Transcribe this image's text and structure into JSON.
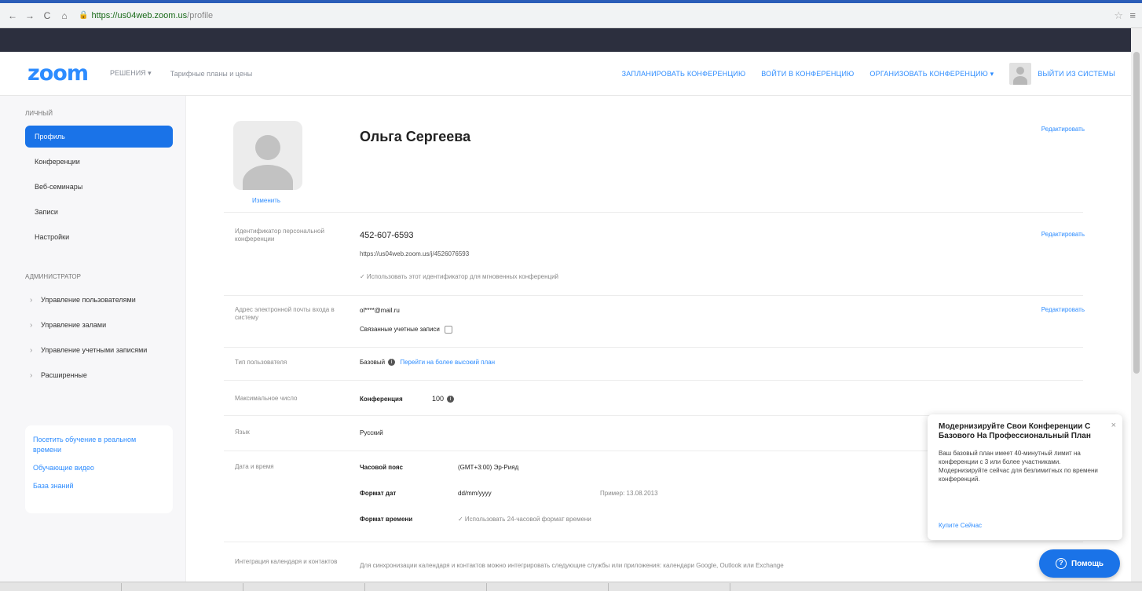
{
  "browser": {
    "url_host": "https://us04web.zoom.us",
    "url_path": "/profile"
  },
  "header": {
    "logo": "zoom",
    "nav": [
      "РЕШЕНИЯ ▾",
      "Тарифные планы и цены"
    ],
    "links": [
      "ЗАПЛАНИРОВАТЬ КОНФЕРЕНЦИЮ",
      "ВОЙТИ В КОНФЕРЕНЦИЮ",
      "ОРГАНИЗОВАТЬ КОНФЕРЕНЦИЮ ▾"
    ],
    "signout": "ВЫЙТИ ИЗ СИСТЕМЫ"
  },
  "sidebar": {
    "personal_title": "ЛИЧНЫЙ",
    "personal_items": [
      "Профиль",
      "Конференции",
      "Веб-семинары",
      "Записи",
      "Настройки"
    ],
    "admin_title": "АДМИНИСТРАТОР",
    "admin_items": [
      "Управление пользователями",
      "Управление залами",
      "Управление учетными записями",
      "Расширенные"
    ],
    "card_links": [
      "Посетить обучение в реальном времени",
      "Обучающие видео",
      "База знаний"
    ]
  },
  "profile": {
    "change_photo": "Изменить",
    "name": "Ольга Сергеева",
    "edit": "Редактировать",
    "pmi_label": "Идентификатор персональной конференции",
    "pmi_value": "452-607-6593",
    "pmi_url": "https://us04web.zoom.us/j/4526076593",
    "pmi_note": "✓ Использовать этот идентификатор для мгновенных конференций",
    "email_label": "Адрес электронной почты входа в систему",
    "email_value": "ol****@mail.ru",
    "linked_accounts": "Связанные учетные записи",
    "type_label": "Тип пользователя",
    "type_value": "Базовый",
    "upgrade_link": "Перейти на более высокий план",
    "capacity_label": "Максимальное число",
    "capacity_key": "Конференция",
    "capacity_value": "100",
    "lang_label": "Язык",
    "lang_value": "Русский",
    "datetime_label": "Дата и время",
    "tz_key": "Часовой пояс",
    "tz_value": "(GMT+3:00) Эр-Рияд",
    "date_key": "Формат дат",
    "date_value": "dd/mm/yyyy",
    "date_example": "Пример: 13.08.2013",
    "time_key": "Формат времени",
    "time_value": "✓ Использовать 24-часовой формат времени",
    "calendar_label": "Интеграция календаря и контактов",
    "calendar_value": "Для синхронизации календаря и контактов можно интегрировать следующие службы или приложения: календари Google, Outlook или Exchange"
  },
  "popup": {
    "title": "Модернизируйте Свои Конференции С Базового На Профессиональный План",
    "body": "Ваш базовый план имеет 40-минутный лимит на конференции с 3 или более участниками. Модернизируйте сейчас для безлимитных по времени конференций.",
    "link": "Купите Сейчас"
  },
  "help": {
    "label": "Помощь"
  }
}
